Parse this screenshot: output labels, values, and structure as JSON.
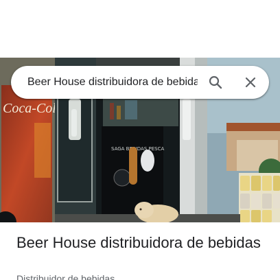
{
  "search": {
    "query": "Beer House distribuidora de bebidas"
  },
  "photo": {
    "sign_text": "Coca-Cola",
    "fridge_text": "SAGA BEBIDAS PESCA"
  },
  "place": {
    "name": "Beer House distribuidora de bebidas",
    "category": "Distribuidor de bebidas"
  },
  "icons": {
    "search": "search-icon",
    "close": "close-icon"
  },
  "colors": {
    "text_primary": "#202124",
    "text_secondary": "#5f6368",
    "icon": "#5f6368"
  }
}
